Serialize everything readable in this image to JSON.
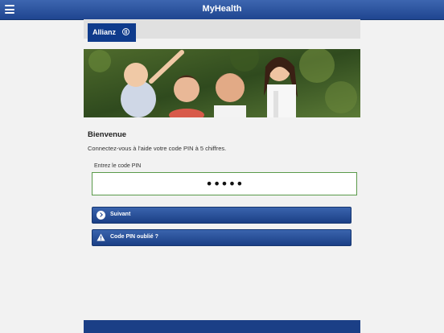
{
  "header": {
    "title": "MyHealth"
  },
  "brand": {
    "logo_text": "Allianz"
  },
  "main": {
    "welcome": "Bienvenue",
    "instructions": "Connectez-vous à l'aide votre code PIN à 5 chiffres.",
    "pin_label": "Entrez le code PIN",
    "pin_value": "•••••"
  },
  "buttons": {
    "next_label": "Suivant",
    "forgot_label": "Code PIN oublié ?"
  },
  "colors": {
    "header_blue": "#1f4590",
    "brand_blue": "#0f3b8c",
    "field_border": "#5a9a4a"
  },
  "icons": {
    "menu": "hamburger-menu-icon",
    "next": "chevron-right-circle-icon",
    "forgot": "warning-triangle-icon"
  }
}
